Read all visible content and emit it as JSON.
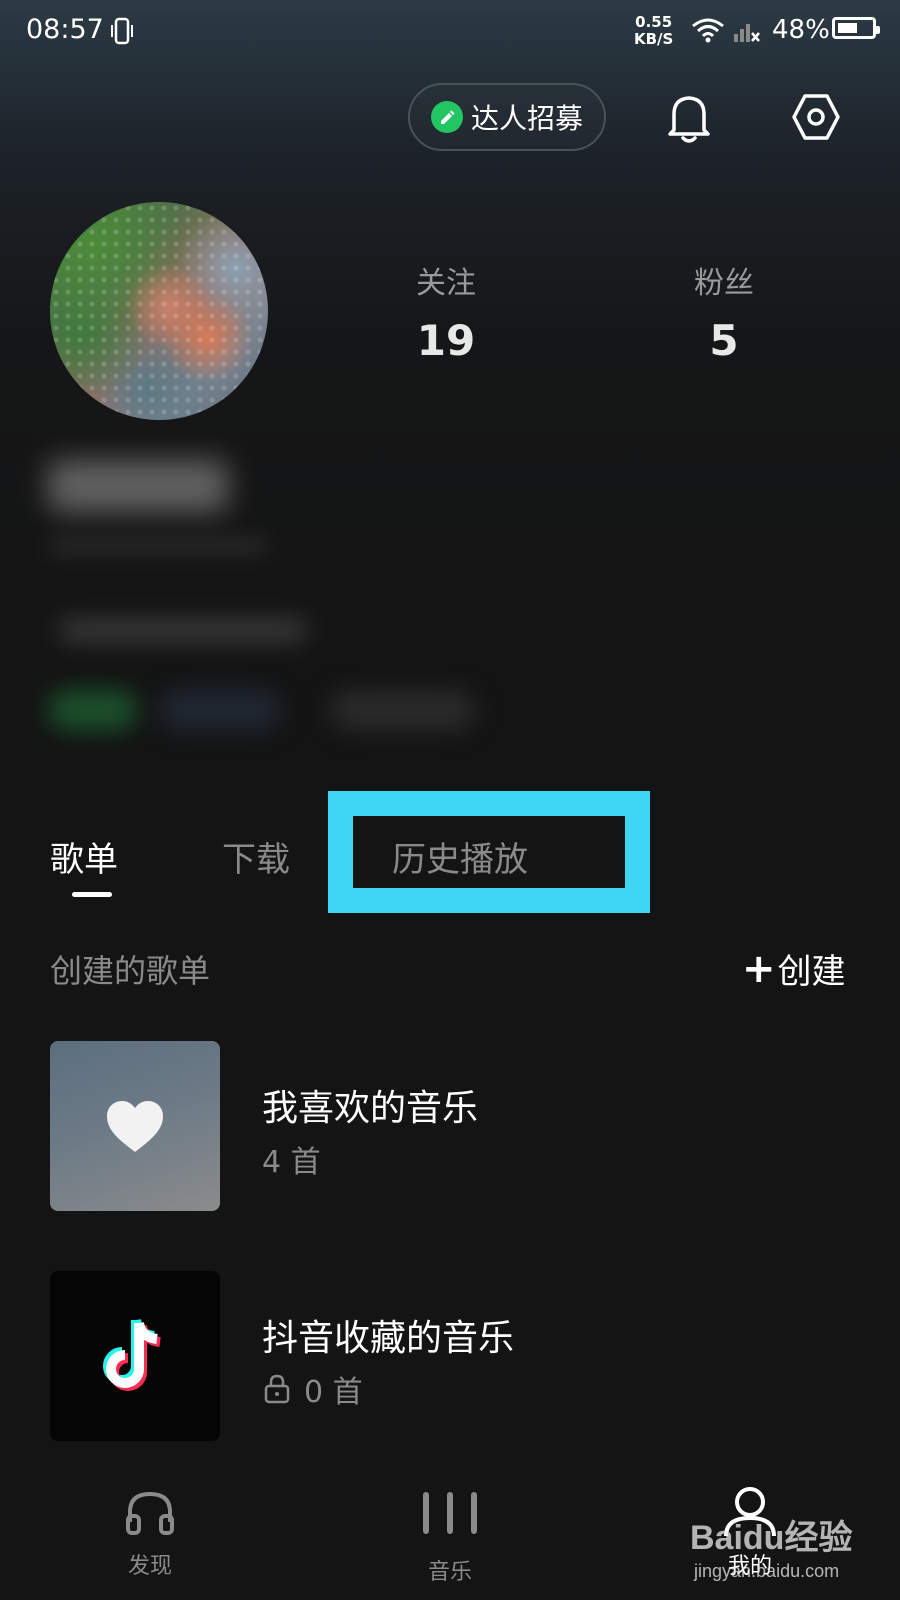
{
  "status_bar": {
    "time": "08:57",
    "net_speed_value": "0.55",
    "net_speed_unit": "KB/S",
    "battery": "48%"
  },
  "header": {
    "recruit_label": "达人招募",
    "icons": [
      "bell-icon",
      "settings-icon"
    ]
  },
  "profile": {
    "following_label": "关注",
    "following_count": "19",
    "fans_label": "粉丝",
    "fans_count": "5"
  },
  "tabs": [
    {
      "label": "歌单",
      "active": true
    },
    {
      "label": "下载",
      "active": false
    },
    {
      "label": "历史播放",
      "active": false
    }
  ],
  "colors": {
    "background": "#141414",
    "highlight_box": "#3fd6f5",
    "recruit_accent": "#23c462"
  },
  "section": {
    "title": "创建的歌单",
    "create_label": "创建"
  },
  "playlists": [
    {
      "title": "我喜欢的音乐",
      "count": "4 首",
      "icon": "heart-icon"
    },
    {
      "title": "抖音收藏的音乐",
      "count": "0 首",
      "icon": "tiktok-logo-icon",
      "locked": true
    }
  ],
  "bottom_nav": [
    {
      "label": "发现",
      "icon": "headphones-icon"
    },
    {
      "label": "音乐",
      "icon": "equalizer-icon"
    },
    {
      "label": "我的",
      "icon": "user-icon",
      "active": true
    }
  ],
  "watermark": {
    "brand": "Baidu经验",
    "url": "jingyan.baidu.com"
  }
}
